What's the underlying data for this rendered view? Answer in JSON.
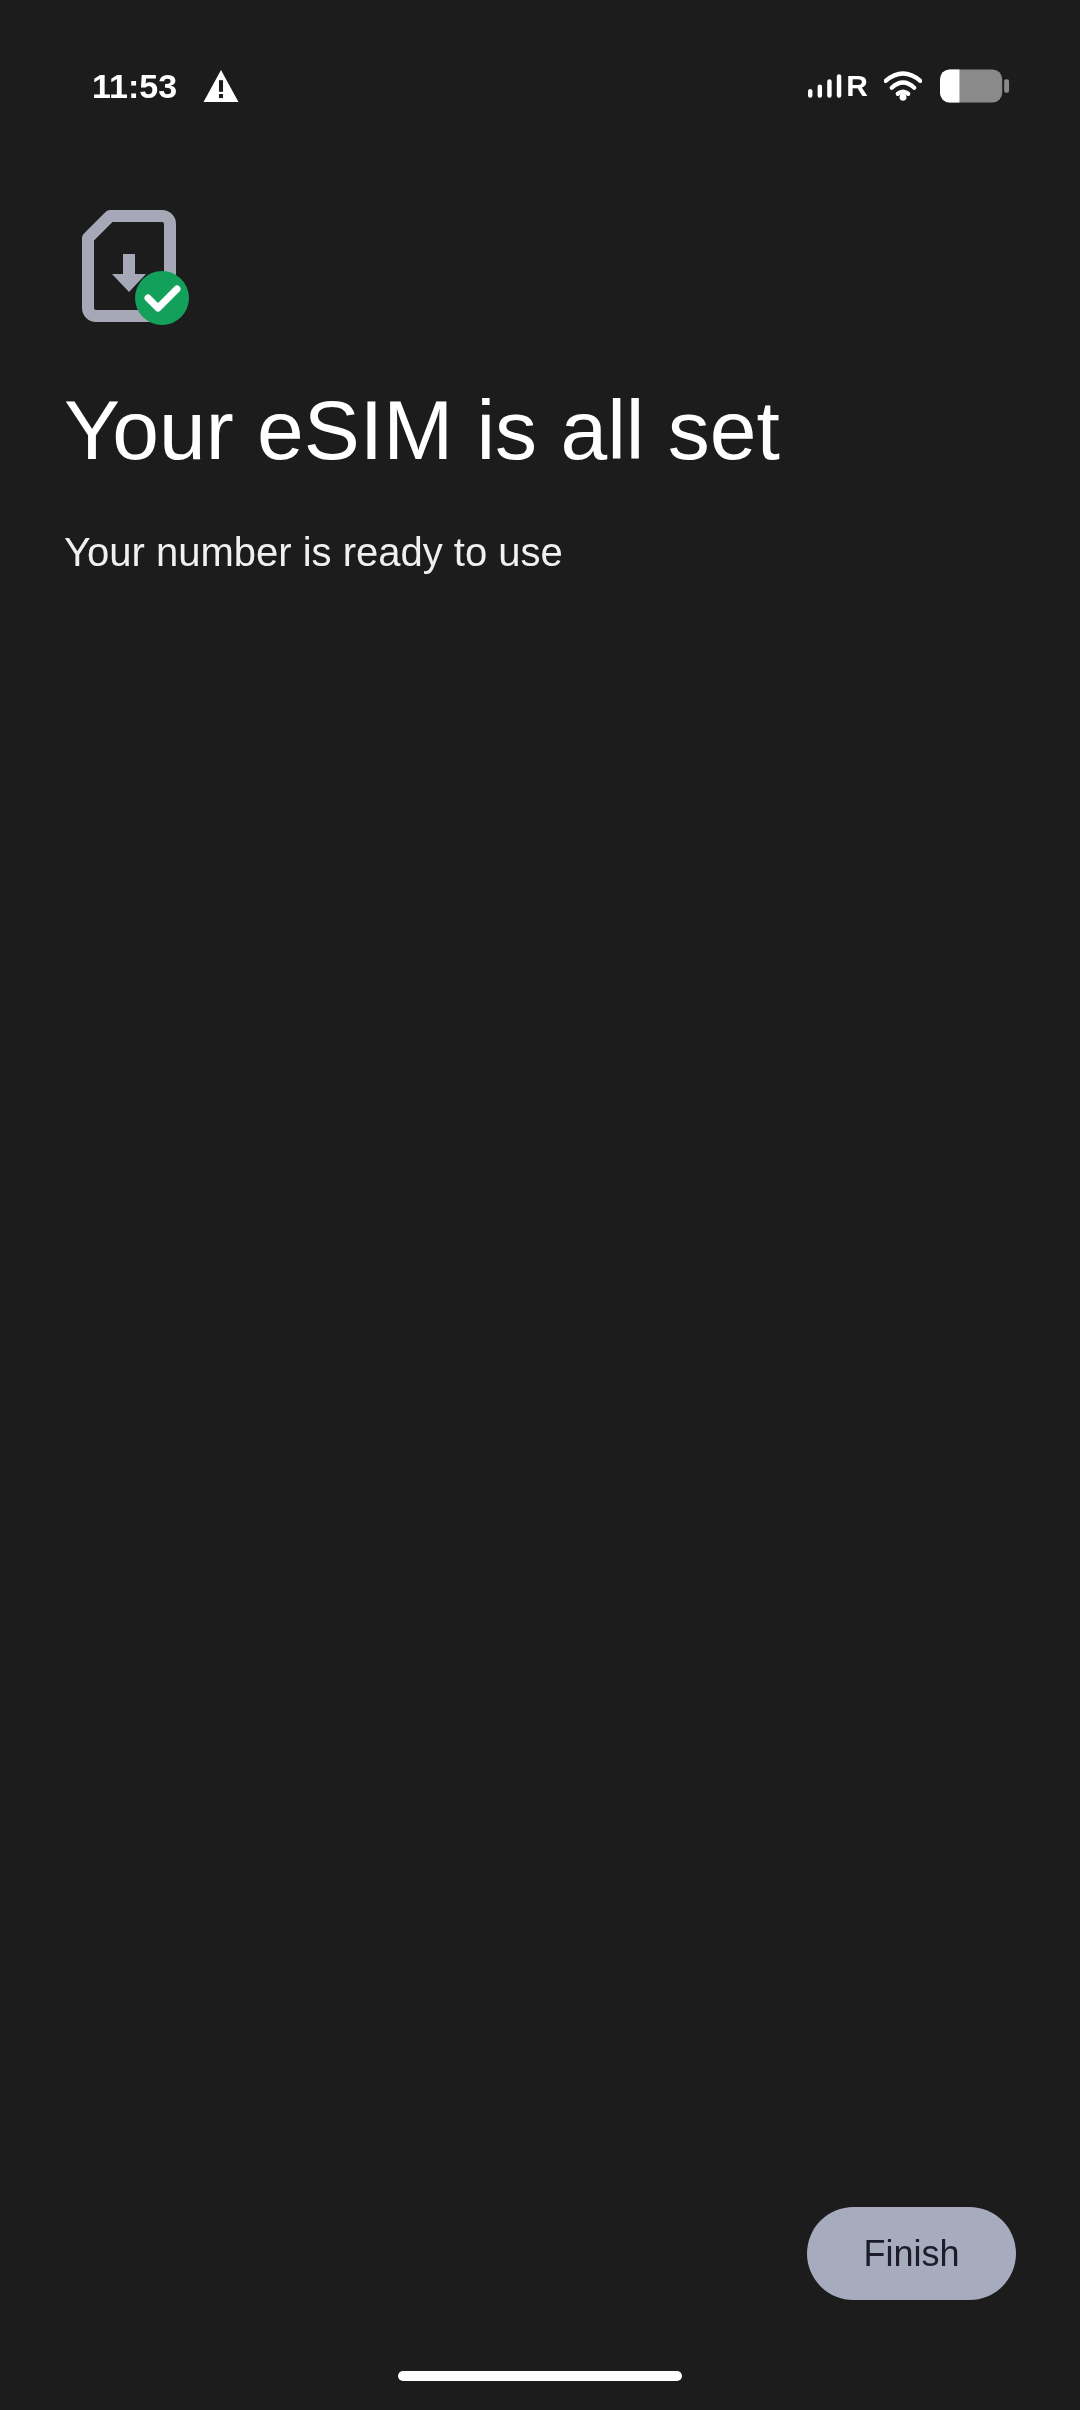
{
  "status_bar": {
    "time": "11:53",
    "network_label": "R"
  },
  "title": "Your eSIM is all set",
  "subtitle": "Your number is ready to use",
  "finish_button": {
    "label": "Finish"
  }
}
